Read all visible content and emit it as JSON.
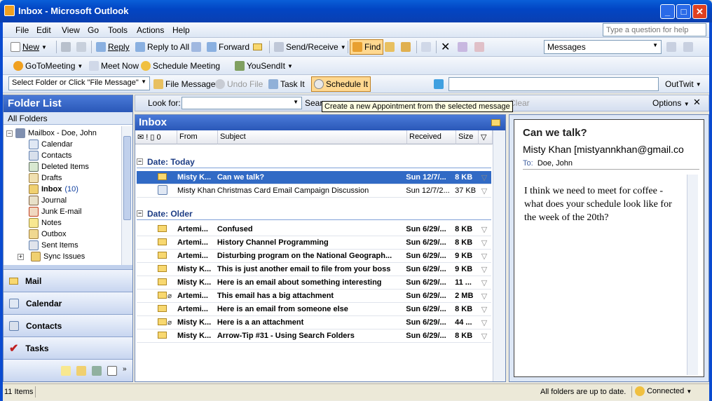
{
  "window": {
    "title": "Inbox - Microsoft Outlook"
  },
  "menu": {
    "items": [
      "File",
      "Edit",
      "View",
      "Go",
      "Tools",
      "Actions",
      "Help"
    ],
    "help_placeholder": "Type a question for help"
  },
  "toolbar1": {
    "new": "New",
    "reply": "Reply",
    "reply_all": "Reply to All",
    "forward": "Forward",
    "send_receive": "Send/Receive",
    "find": "Find",
    "view_select": "Messages"
  },
  "toolbar2": {
    "gotomeeting": "GoToMeeting",
    "meet_now": "Meet Now",
    "schedule_meeting": "Schedule Meeting",
    "yousendit": "YouSendIt"
  },
  "toolbar3": {
    "folder_select": "Select Folder or Click \"File Message\"",
    "file_message": "File Message",
    "undo_file": "Undo File",
    "task_it": "Task It",
    "schedule_it": "Schedule It",
    "outtwit": "OutTwit"
  },
  "tooltip": "Create a new Appointment from the selected message",
  "findbar": {
    "look_for": "Look for:",
    "search": "Searc",
    "clear": "Clear",
    "options": "Options"
  },
  "nav": {
    "title": "Folder List",
    "all_folders": "All Folders",
    "tree": [
      {
        "label": "Mailbox - Doe, John",
        "icon": "mailbox-icon"
      },
      {
        "label": "Calendar",
        "icon": "calendar-icon"
      },
      {
        "label": "Contacts",
        "icon": "contacts-icon"
      },
      {
        "label": "Deleted Items",
        "icon": "deleted-items-icon"
      },
      {
        "label": "Drafts",
        "icon": "drafts-icon"
      },
      {
        "label": "Inbox",
        "count": "(10)",
        "icon": "inbox-icon"
      },
      {
        "label": "Journal",
        "icon": "journal-icon"
      },
      {
        "label": "Junk E-mail",
        "icon": "junk-icon"
      },
      {
        "label": "Notes",
        "icon": "notes-icon"
      },
      {
        "label": "Outbox",
        "icon": "outbox-icon"
      },
      {
        "label": "Sent Items",
        "icon": "sent-icon"
      },
      {
        "label": "Sync Issues",
        "icon": "sync-icon"
      }
    ],
    "buttons": [
      "Mail",
      "Calendar",
      "Contacts",
      "Tasks"
    ]
  },
  "inbox": {
    "title": "Inbox",
    "columns": [
      "From",
      "Subject",
      "Received",
      "Size"
    ],
    "groups": [
      {
        "label": "Date: Today",
        "rows": [
          {
            "from": "Misty K...",
            "subject": "Can we talk?",
            "received": "Sun 12/7/...",
            "size": "8 KB",
            "unread": true,
            "selected": true,
            "attach": false,
            "icon": "envelope-icon"
          },
          {
            "from": "Misty Khan",
            "subject": "Christmas Card Email Campaign Discussion",
            "received": "Sun 12/7/2...",
            "size": "37 KB",
            "unread": false,
            "selected": false,
            "attach": false,
            "icon": "calendar-icon"
          }
        ]
      },
      {
        "label": "Date: Older",
        "rows": [
          {
            "from": "Artemi...",
            "subject": "Confused",
            "received": "Sun 6/29/...",
            "size": "8 KB",
            "unread": true,
            "attach": false
          },
          {
            "from": "Artemi...",
            "subject": "History Channel Programming",
            "received": "Sun 6/29/...",
            "size": "8 KB",
            "unread": true,
            "attach": false
          },
          {
            "from": "Artemi...",
            "subject": "Disturbing program on the National Geograph...",
            "received": "Sun 6/29/...",
            "size": "9 KB",
            "unread": true,
            "attach": false
          },
          {
            "from": "Misty K...",
            "subject": "This is just another email to file from your boss",
            "received": "Sun 6/29/...",
            "size": "9 KB",
            "unread": true,
            "attach": false
          },
          {
            "from": "Misty K...",
            "subject": "Here is an email about something interesting",
            "received": "Sun 6/29/...",
            "size": "11 ...",
            "unread": true,
            "attach": false
          },
          {
            "from": "Artemi...",
            "subject": "This email has a big attachment",
            "received": "Sun 6/29/...",
            "size": "2 MB",
            "unread": true,
            "attach": true
          },
          {
            "from": "Artemi...",
            "subject": "Here is an email from someone else",
            "received": "Sun 6/29/...",
            "size": "8 KB",
            "unread": true,
            "attach": false
          },
          {
            "from": "Misty K...",
            "subject": "Here is a an attachment",
            "received": "Sun 6/29/...",
            "size": "44 ...",
            "unread": true,
            "attach": true
          },
          {
            "from": "Misty K...",
            "subject": "Arrow-Tip #31 - Using Search Folders",
            "received": "Sun 6/29/...",
            "size": "8 KB",
            "unread": true,
            "attach": false
          }
        ]
      }
    ]
  },
  "reading": {
    "subject": "Can we talk?",
    "from": "Misty Khan [mistyannkhan@gmail.co",
    "to_label": "To:",
    "to": "Doe, John",
    "body": "I think we need to meet for coffee - what does your schedule look like for the week of the 20th?"
  },
  "status": {
    "items": "11 Items",
    "sync": "All folders are up to date.",
    "connection": "Connected"
  }
}
